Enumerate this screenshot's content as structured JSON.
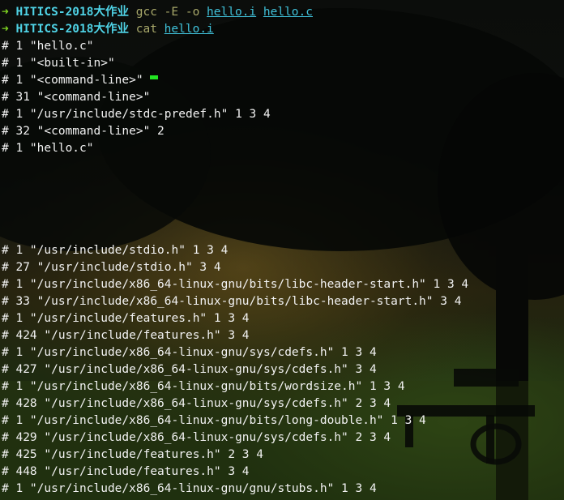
{
  "prompts": [
    {
      "arrow": "➜",
      "dir": "HITICS-2018大作业",
      "cmd": "gcc -E -o",
      "args": [
        "hello.i",
        "hello.c"
      ]
    },
    {
      "arrow": "➜",
      "dir": "HITICS-2018大作业",
      "cmd": "cat",
      "args": [
        "hello.i"
      ]
    }
  ],
  "output_top": [
    "# 1 \"hello.c\"",
    "# 1 \"<built-in>\"",
    "# 1 \"<command-line>\"",
    "# 31 \"<command-line>\"",
    "# 1 \"/usr/include/stdc-predef.h\" 1 3 4",
    "# 32 \"<command-line>\" 2",
    "# 1 \"hello.c\""
  ],
  "output_bottom": [
    "# 1 \"/usr/include/stdio.h\" 1 3 4",
    "# 27 \"/usr/include/stdio.h\" 3 4",
    "# 1 \"/usr/include/x86_64-linux-gnu/bits/libc-header-start.h\" 1 3 4",
    "# 33 \"/usr/include/x86_64-linux-gnu/bits/libc-header-start.h\" 3 4",
    "# 1 \"/usr/include/features.h\" 1 3 4",
    "# 424 \"/usr/include/features.h\" 3 4",
    "# 1 \"/usr/include/x86_64-linux-gnu/sys/cdefs.h\" 1 3 4",
    "# 427 \"/usr/include/x86_64-linux-gnu/sys/cdefs.h\" 3 4",
    "# 1 \"/usr/include/x86_64-linux-gnu/bits/wordsize.h\" 1 3 4",
    "# 428 \"/usr/include/x86_64-linux-gnu/sys/cdefs.h\" 2 3 4",
    "# 1 \"/usr/include/x86_64-linux-gnu/bits/long-double.h\" 1 3 4",
    "# 429 \"/usr/include/x86_64-linux-gnu/sys/cdefs.h\" 2 3 4",
    "# 425 \"/usr/include/features.h\" 2 3 4",
    "# 448 \"/usr/include/features.h\" 3 4",
    "# 1 \"/usr/include/x86_64-linux-gnu/gnu/stubs.h\" 1 3 4"
  ],
  "colors": {
    "prompt_arrow": "#7ed321",
    "directory": "#4fd3e6",
    "command": "#a8a86a",
    "argument": "#3fc0d8",
    "output_text": "#f2f2f2",
    "cursor": "#22e422"
  }
}
